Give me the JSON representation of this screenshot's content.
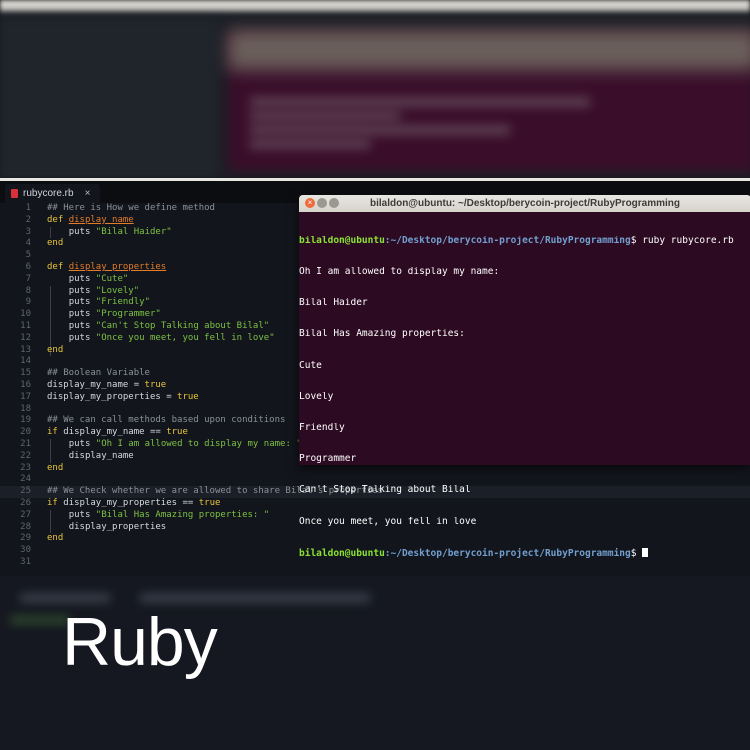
{
  "editor": {
    "tab_label": "rubycore.rb",
    "tab_close": "×",
    "lines": [
      {
        "n": "1"
      },
      {
        "n": "2"
      },
      {
        "n": "3"
      },
      {
        "n": "4"
      },
      {
        "n": "5"
      },
      {
        "n": "6"
      },
      {
        "n": "7"
      },
      {
        "n": "8"
      },
      {
        "n": "9"
      },
      {
        "n": "10"
      },
      {
        "n": "11"
      },
      {
        "n": "12"
      },
      {
        "n": "13"
      },
      {
        "n": "14"
      },
      {
        "n": "15"
      },
      {
        "n": "16"
      },
      {
        "n": "17"
      },
      {
        "n": "18"
      },
      {
        "n": "19"
      },
      {
        "n": "20"
      },
      {
        "n": "21"
      },
      {
        "n": "22"
      },
      {
        "n": "23"
      },
      {
        "n": "24"
      },
      {
        "n": "25"
      },
      {
        "n": "26"
      },
      {
        "n": "27"
      },
      {
        "n": "28"
      },
      {
        "n": "29"
      },
      {
        "n": "30"
      },
      {
        "n": "31"
      }
    ],
    "code": {
      "l1": "## Here is How we define method",
      "def": "def",
      "l2_name": "display_name",
      "puts": "puts",
      "l3_str": "\"Bilal Haider\"",
      "end": "end",
      "l6_name": "display_properties",
      "l7_str": "\"Cute\"",
      "l8_str": "\"Lovely\"",
      "l9_str": "\"Friendly\"",
      "l10_str": "\"Programmer\"",
      "l11_str": "\"Can't Stop Talking about Bilal\"",
      "l12_str": "\"Once you meet, you fell in love\"",
      "l15": "## Boolean Variable",
      "l16_var": "display_my_name = ",
      "true": "true",
      "l17_var": "display_my_properties = ",
      "l19": "## We can call methods based upon conditions",
      "if": "if",
      "l20_cond": " display_my_name == ",
      "l21_str": "\"Oh I am allowed to display my name: \"",
      "l22": "display_name",
      "l25": "## We Check whether we are allowed to share Bilal's properties",
      "l26_cond": " display_my_properties == ",
      "l27_str": "\"Bilal Has Amazing properties: \"",
      "l28": "display_properties"
    }
  },
  "terminal": {
    "title": "bilaldon@ubuntu: ~/Desktop/berycoin-project/RubyProgramming",
    "prompt_user": "bilaldon@ubuntu",
    "prompt_path": ":~/Desktop/berycoin-project/RubyProgramming",
    "prompt_sign": "$",
    "command": " ruby rubycore.rb",
    "output": [
      "Oh I am allowed to display my name:",
      "Bilal Haider",
      "Bilal Has Amazing properties:",
      "Cute",
      "Lovely",
      "Friendly",
      "Programmer",
      "Can't Stop Talking about Bilal",
      "Once you meet, you fell in love"
    ]
  },
  "overlay_title": "Ruby",
  "colors": {
    "terminal_bg": "#2c0a22",
    "editor_bg": "#12151c",
    "keyword": "#e8c53a",
    "function": "#e37d2a",
    "string": "#7ec142"
  }
}
